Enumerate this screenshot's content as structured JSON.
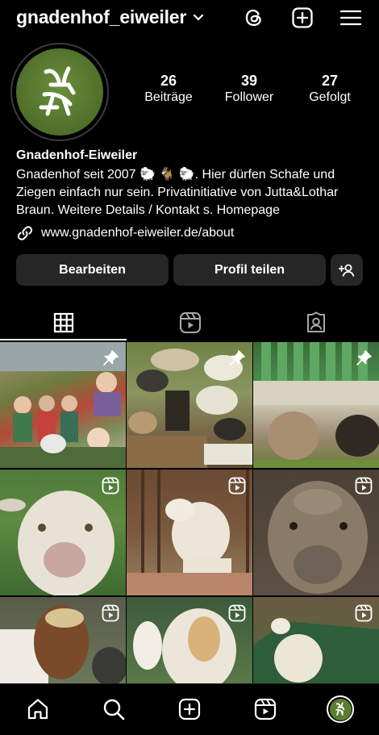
{
  "header": {
    "username": "gnadenhof_eiweiler"
  },
  "profile": {
    "avatar_text": "",
    "display_name": "Gnadenhof-Eiweiler",
    "bio": "Gnadenhof seit 2007 🐑 🐐 🐑. Hier dürfen Schafe und Ziegen einfach nur sein. Privatinitiative von Jutta&Lothar Braun. Weitere Details / Kontakt s. Homepage",
    "link": "www.gnadenhof-eiweiler.de/about",
    "stats": {
      "posts": {
        "value": "26",
        "label": "Beiträge"
      },
      "followers": {
        "value": "39",
        "label": "Follower"
      },
      "following": {
        "value": "27",
        "label": "Gefolgt"
      }
    }
  },
  "actions": {
    "edit_label": "Bearbeiten",
    "share_label": "Profil teilen"
  },
  "colors": {
    "background": "#000000",
    "button": "#262626",
    "avatar_green": "#5b7d30"
  },
  "posts": [
    {
      "type": "photo",
      "pinned": true
    },
    {
      "type": "photo",
      "pinned": true
    },
    {
      "type": "photo",
      "pinned": true
    },
    {
      "type": "reel",
      "pinned": false
    },
    {
      "type": "reel",
      "pinned": false
    },
    {
      "type": "reel",
      "pinned": false
    },
    {
      "type": "reel",
      "pinned": false
    },
    {
      "type": "reel",
      "pinned": false
    },
    {
      "type": "reel",
      "pinned": false
    }
  ]
}
